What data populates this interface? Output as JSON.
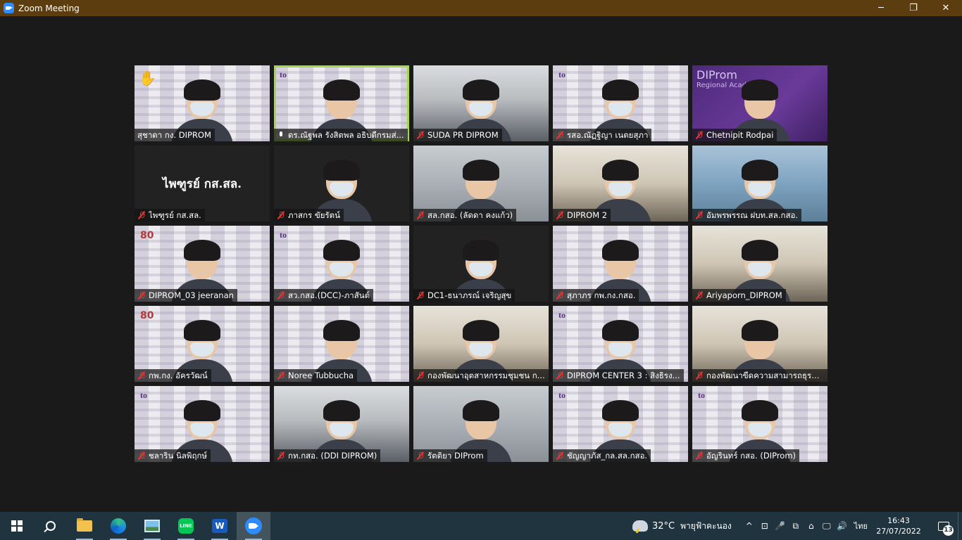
{
  "window": {
    "title": "Zoom Meeting",
    "controls": [
      "─",
      "❐",
      "✕"
    ]
  },
  "participants": [
    {
      "name": "สุชาดา กง. DIPROM",
      "bg": "white-bg",
      "muted": false,
      "raised_hand": true,
      "logo": ""
    },
    {
      "name": "ดร.ณัฐพล รังสิตพล อธิบดีกรมส่...",
      "bg": "white-bg",
      "muted": false,
      "active": true,
      "logo": "tl"
    },
    {
      "name": "SUDA PR DIPROM",
      "bg": "office",
      "muted": true,
      "logo": ""
    },
    {
      "name": "รสอ.ณัฏฐิญา เนตยสุภา",
      "bg": "white-bg",
      "muted": true,
      "logo": "tl"
    },
    {
      "name": "Chetnipit Rodpai",
      "bg": "purple",
      "muted": true,
      "logo": "banner"
    },
    {
      "name": "ไพฑูรย์ กส.สล.",
      "bg": "dark",
      "muted": true,
      "name_only": "ไพฑูรย์ กส.สล."
    },
    {
      "name": "ภาสกร ขัยรัตน์",
      "bg": "dark",
      "muted": true,
      "logo": ""
    },
    {
      "name": "สล.กสอ. (ลัดดา คงแก้ว)",
      "bg": "blur-grey",
      "muted": true,
      "logo": ""
    },
    {
      "name": "DIPROM 2",
      "bg": "room",
      "muted": true,
      "logo": ""
    },
    {
      "name": "อัมพรพรรณ ฝบท.สล.กสอ.",
      "bg": "blur-blue",
      "muted": true,
      "logo": ""
    },
    {
      "name": "DIPROM_03 jeeranan",
      "bg": "white-bg",
      "muted": true,
      "logo": "80"
    },
    {
      "name": "สว.กสอ.(DCC)-ภาสันต์",
      "bg": "white-bg",
      "muted": true,
      "logo": "tl"
    },
    {
      "name": "DC1-ธนาภรณ์ เจริญสุข",
      "bg": "dark",
      "muted": true,
      "logo": ""
    },
    {
      "name": "สุภาภร กพ.กง.กสอ.",
      "bg": "white-bg",
      "muted": true,
      "logo": ""
    },
    {
      "name": "Ariyaporn_DIPROM",
      "bg": "room",
      "muted": true,
      "logo": ""
    },
    {
      "name": "กพ.กง. อัครวัฒน์",
      "bg": "white-bg",
      "muted": true,
      "logo": "80"
    },
    {
      "name": "Noree Tubbucha",
      "bg": "white-bg",
      "muted": true,
      "logo": ""
    },
    {
      "name": "กองพัฒนาอุตสาหกรรมชุมชน ก...",
      "bg": "room",
      "muted": true,
      "logo": ""
    },
    {
      "name": "DIPROM CENTER 3 : สิงธิรง...",
      "bg": "white-bg",
      "muted": true,
      "logo": "tl"
    },
    {
      "name": "กองพัฒนาขีดความสามารถธุรกิ...",
      "bg": "room",
      "muted": true,
      "logo": ""
    },
    {
      "name": "ชลาริน นิลพิฤกษ์",
      "bg": "white-bg",
      "muted": true,
      "logo": "tl"
    },
    {
      "name": "กท.กสอ. (DDI DIPROM)",
      "bg": "office",
      "muted": true,
      "logo": ""
    },
    {
      "name": "รัตติยา DIProm",
      "bg": "blur-grey",
      "muted": true,
      "logo": ""
    },
    {
      "name": "ชัญญาภัส_กล.สล.กสอ.",
      "bg": "white-bg",
      "muted": true,
      "logo": "tl"
    },
    {
      "name": "อัญรินทร์ กสอ. (DIProm)",
      "bg": "white-bg",
      "muted": true,
      "logo": "tl"
    }
  ],
  "branding": {
    "tl_logo": "to",
    "logo_80": "80",
    "banner_title": "DIProm",
    "banner_sub": "Regional Academy"
  },
  "taskbar": {
    "apps": [
      "start-icon",
      "search-icon",
      "file-explorer-icon",
      "edge-icon",
      "photos-icon",
      "line-icon",
      "word-icon",
      "zoom-icon"
    ],
    "line_label": "LINE",
    "word_label": "W",
    "weather": {
      "temp": "32°C",
      "condition": "พายุฟ้าคะนอง"
    },
    "tray_glyphs": [
      "^",
      "⊡",
      "🎤",
      "⧉",
      "⌂",
      "🖵",
      "🔊"
    ],
    "language": "ไทย",
    "time": "16:43",
    "date": "27/07/2022",
    "notification_count": "13"
  },
  "colors": {
    "titlebar": "#5c3d10",
    "taskbar": "#20343f",
    "active_speaker": "#a6d64c",
    "muted": "#e33"
  }
}
